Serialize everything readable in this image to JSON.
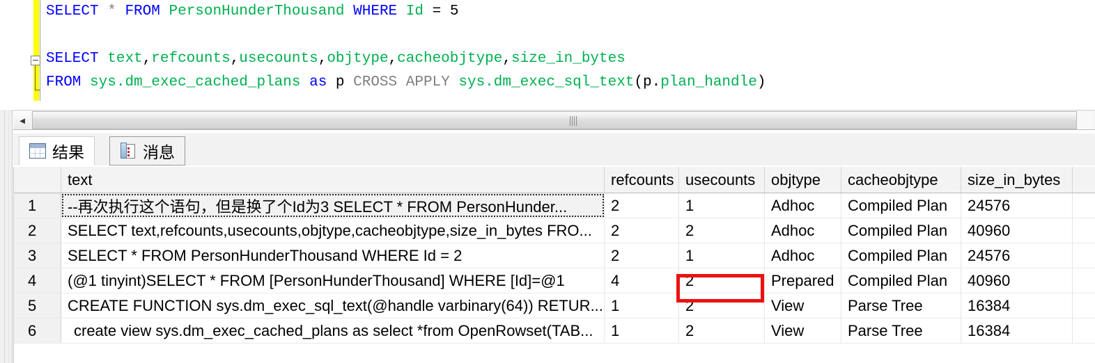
{
  "editor": {
    "lines": [
      {
        "id": "line-select-person",
        "tokens": [
          {
            "t": "SELECT",
            "c": "kw"
          },
          {
            "t": " ",
            "c": "plain"
          },
          {
            "t": "*",
            "c": "op"
          },
          {
            "t": " ",
            "c": "plain"
          },
          {
            "t": "FROM",
            "c": "kw"
          },
          {
            "t": " ",
            "c": "plain"
          },
          {
            "t": "PersonHunderThousand",
            "c": "obj"
          },
          {
            "t": " ",
            "c": "plain"
          },
          {
            "t": "WHERE",
            "c": "kw"
          },
          {
            "t": " ",
            "c": "plain"
          },
          {
            "t": "Id",
            "c": "obj"
          },
          {
            "t": " ",
            "c": "plain"
          },
          {
            "t": "=",
            "c": "plain"
          },
          {
            "t": " ",
            "c": "plain"
          },
          {
            "t": "5",
            "c": "num"
          }
        ]
      },
      {
        "id": "line-blank",
        "tokens": []
      },
      {
        "id": "line-select-columns",
        "tokens": [
          {
            "t": "SELECT",
            "c": "kw"
          },
          {
            "t": " ",
            "c": "plain"
          },
          {
            "t": "text",
            "c": "obj"
          },
          {
            "t": ",",
            "c": "plain"
          },
          {
            "t": "refcounts",
            "c": "obj"
          },
          {
            "t": ",",
            "c": "plain"
          },
          {
            "t": "usecounts",
            "c": "obj"
          },
          {
            "t": ",",
            "c": "plain"
          },
          {
            "t": "objtype",
            "c": "obj"
          },
          {
            "t": ",",
            "c": "plain"
          },
          {
            "t": "cacheobjtype",
            "c": "obj"
          },
          {
            "t": ",",
            "c": "plain"
          },
          {
            "t": "size_in_bytes",
            "c": "obj"
          }
        ]
      },
      {
        "id": "line-from-cross-apply",
        "tokens": [
          {
            "t": "FROM",
            "c": "kw"
          },
          {
            "t": " ",
            "c": "plain"
          },
          {
            "t": "sys.dm_exec_cached_plans",
            "c": "obj"
          },
          {
            "t": " ",
            "c": "plain"
          },
          {
            "t": "as",
            "c": "kw"
          },
          {
            "t": " p ",
            "c": "plain"
          },
          {
            "t": "CROSS APPLY",
            "c": "kw2"
          },
          {
            "t": " ",
            "c": "plain"
          },
          {
            "t": "sys.dm_exec_sql_text",
            "c": "obj"
          },
          {
            "t": "(p.",
            "c": "plain"
          },
          {
            "t": "plan_handle",
            "c": "obj"
          },
          {
            "t": ")",
            "c": "plain"
          }
        ]
      }
    ]
  },
  "scrollbar": {
    "left_arrow": "◄"
  },
  "tabs": [
    {
      "id": "tab-results",
      "label": "结果",
      "icon": "grid-icon",
      "active": true
    },
    {
      "id": "tab-messages",
      "label": "消息",
      "icon": "message-icon",
      "active": false
    }
  ],
  "grid": {
    "columns": [
      {
        "key": "rownum",
        "label": ""
      },
      {
        "key": "text",
        "label": "text"
      },
      {
        "key": "refcounts",
        "label": "refcounts"
      },
      {
        "key": "usecounts",
        "label": "usecounts"
      },
      {
        "key": "objtype",
        "label": "objtype"
      },
      {
        "key": "cacheobjtype",
        "label": "cacheobjtype"
      },
      {
        "key": "size_in_bytes",
        "label": "size_in_bytes"
      }
    ],
    "rows": [
      {
        "rownum": "1",
        "text": "--再次执行这个语句，但是换了个Id为3  SELECT * FROM PersonHunder...",
        "refcounts": "2",
        "usecounts": "1",
        "objtype": "Adhoc",
        "cacheobjtype": "Compiled Plan",
        "size_in_bytes": "24576",
        "focused": true,
        "indent": 0
      },
      {
        "rownum": "2",
        "text": "SELECT text,refcounts,usecounts,objtype,cacheobjtype,size_in_bytes  FRO...",
        "refcounts": "2",
        "usecounts": "2",
        "objtype": "Adhoc",
        "cacheobjtype": "Compiled Plan",
        "size_in_bytes": "40960",
        "focused": false,
        "indent": 0
      },
      {
        "rownum": "3",
        "text": "SELECT * FROM PersonHunderThousand WHERE Id = 2",
        "refcounts": "2",
        "usecounts": "1",
        "objtype": "Adhoc",
        "cacheobjtype": "Compiled Plan",
        "size_in_bytes": "24576",
        "focused": false,
        "indent": 0
      },
      {
        "rownum": "4",
        "text": "(@1 tinyint)SELECT * FROM [PersonHunderThousand] WHERE [Id]=@1",
        "refcounts": "4",
        "usecounts": "2",
        "objtype": "Prepared",
        "cacheobjtype": "Compiled Plan",
        "size_in_bytes": "40960",
        "focused": false,
        "indent": 0
      },
      {
        "rownum": "5",
        "text": "CREATE FUNCTION sys.dm_exec_sql_text(@handle varbinary(64))  RETUR...",
        "refcounts": "1",
        "usecounts": "2",
        "objtype": "View",
        "cacheobjtype": "Parse Tree",
        "size_in_bytes": "16384",
        "focused": false,
        "indent": 0
      },
      {
        "rownum": "6",
        "text": "create view sys.dm_exec_cached_plans as select *from OpenRowset(TAB...",
        "refcounts": "1",
        "usecounts": "2",
        "objtype": "View",
        "cacheobjtype": "Parse Tree",
        "size_in_bytes": "16384",
        "focused": false,
        "indent": 1
      }
    ]
  },
  "annotation": {
    "highlight_color": "#ee1111",
    "target_row": "4",
    "target_column": "usecounts",
    "target_value": "2"
  }
}
